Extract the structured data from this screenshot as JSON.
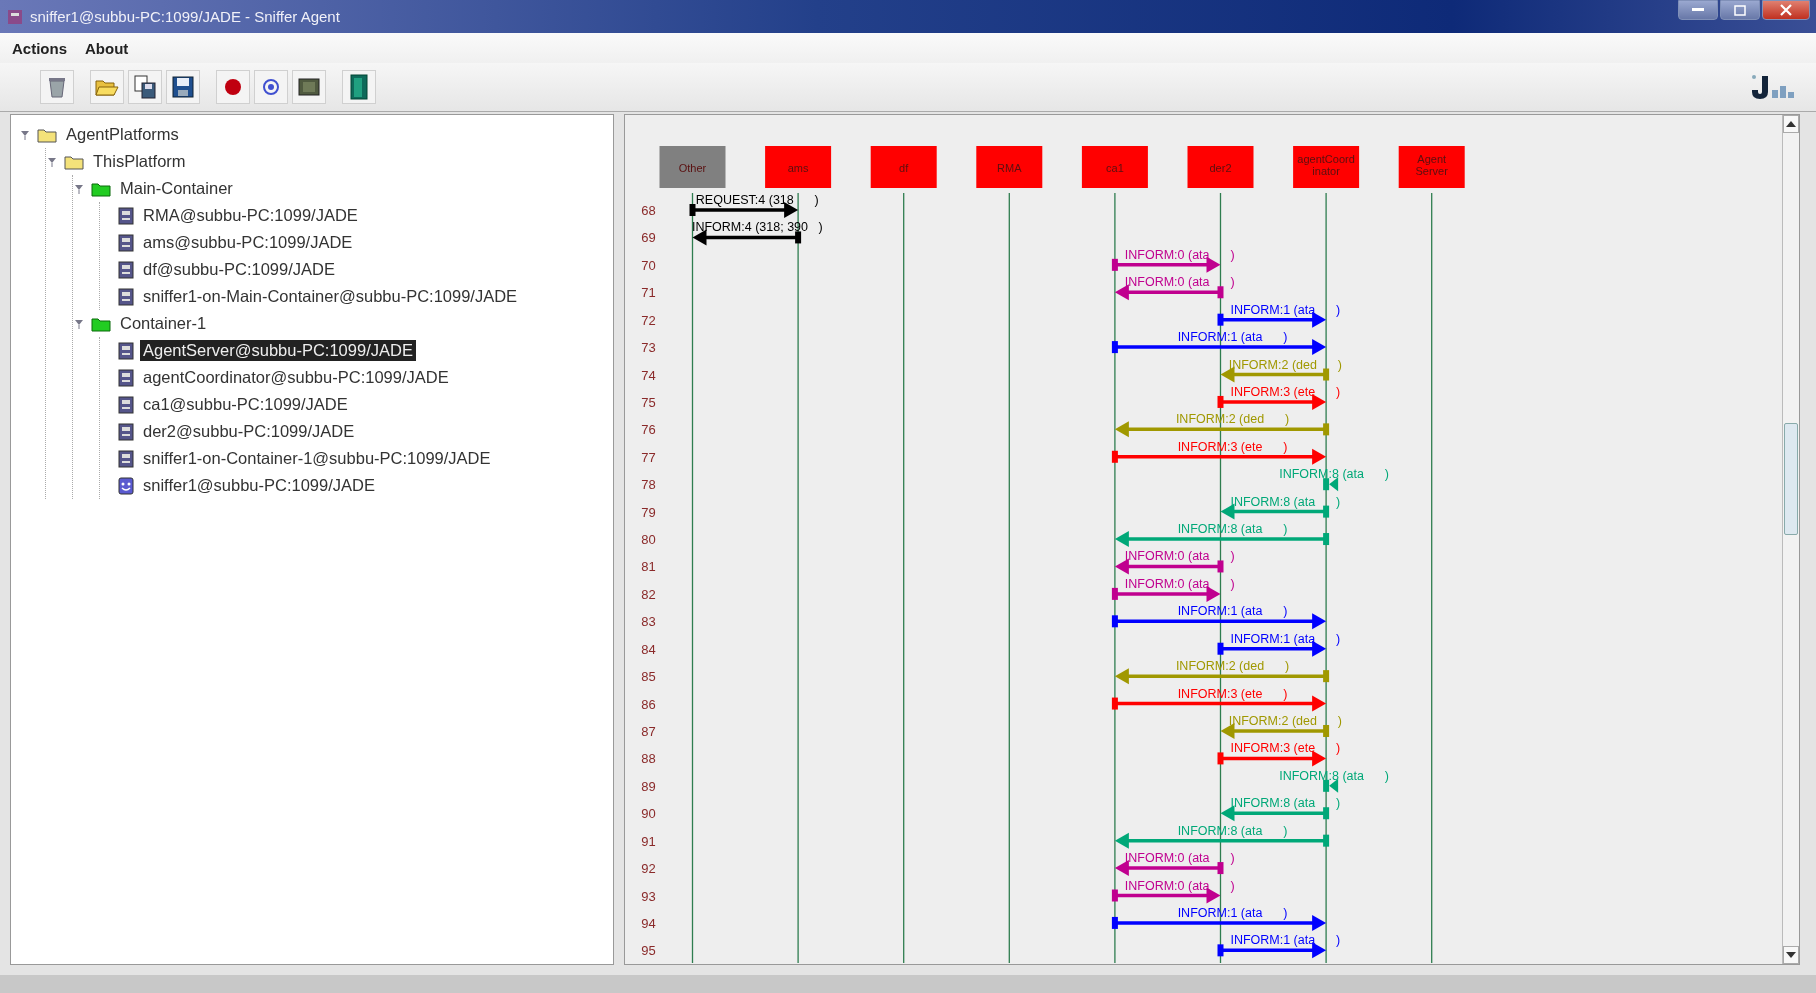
{
  "window": {
    "title": "sniffer1@subbu-PC:1099/JADE - Sniffer Agent"
  },
  "menu": [
    {
      "label": "Actions"
    },
    {
      "label": "About"
    }
  ],
  "tree": [
    {
      "label": "AgentPlatforms",
      "kind": "folder",
      "selected": false,
      "expanded": true,
      "children": [
        {
          "label": "ThisPlatform",
          "kind": "folder",
          "selected": false,
          "expanded": true,
          "children": [
            {
              "label": "Main-Container",
              "kind": "container",
              "selected": false,
              "expanded": true,
              "children": [
                {
                  "label": "RMA@subbu-PC:1099/JADE",
                  "kind": "agent",
                  "selected": false
                },
                {
                  "label": "ams@subbu-PC:1099/JADE",
                  "kind": "agent",
                  "selected": false
                },
                {
                  "label": "df@subbu-PC:1099/JADE",
                  "kind": "agent",
                  "selected": false
                },
                {
                  "label": "sniffer1-on-Main-Container@subbu-PC:1099/JADE",
                  "kind": "agent",
                  "selected": false
                }
              ]
            },
            {
              "label": "Container-1",
              "kind": "container",
              "selected": false,
              "expanded": true,
              "children": [
                {
                  "label": "AgentServer@subbu-PC:1099/JADE",
                  "kind": "agent",
                  "selected": true
                },
                {
                  "label": "agentCoordinator@subbu-PC:1099/JADE",
                  "kind": "agent",
                  "selected": false
                },
                {
                  "label": "ca1@subbu-PC:1099/JADE",
                  "kind": "agent",
                  "selected": false
                },
                {
                  "label": "der2@subbu-PC:1099/JADE",
                  "kind": "agent",
                  "selected": false
                },
                {
                  "label": "sniffer1-on-Container-1@subbu-PC:1099/JADE",
                  "kind": "agent",
                  "selected": false
                },
                {
                  "label": "sniffer1@subbu-PC:1099/JADE",
                  "kind": "sniffer",
                  "selected": false
                }
              ]
            }
          ]
        }
      ]
    }
  ],
  "agents": [
    {
      "label": "Other",
      "color": "#808080"
    },
    {
      "label": "ams",
      "color": "#ff0000"
    },
    {
      "label": "df",
      "color": "#ff0000"
    },
    {
      "label": "RMA",
      "color": "#ff0000"
    },
    {
      "label": "ca1",
      "color": "#ff0000"
    },
    {
      "label": "der2",
      "color": "#ff0000"
    },
    {
      "label": "agentCoord inator",
      "color": "#ff0000"
    },
    {
      "label": "Agent Server",
      "color": "#ff0000"
    }
  ],
  "messages": [
    {
      "row": "68",
      "label": "REQUEST:4 (318      )",
      "color": "#000000"
    },
    {
      "row": "69",
      "label": "INFORM:4 (318; 390   )",
      "color": "#000000"
    },
    {
      "row": "70",
      "label": "INFORM:0 (ata      )",
      "color": "#c0008f"
    },
    {
      "row": "71",
      "label": "INFORM:0 (ata      )",
      "color": "#c0008f"
    },
    {
      "row": "72",
      "label": "INFORM:1 (ata      )",
      "color": "#0000ff"
    },
    {
      "row": "73",
      "label": "INFORM:1 (ata      )",
      "color": "#0000ff"
    },
    {
      "row": "74",
      "label": "INFORM:2 (ded      )",
      "color": "#a09800"
    },
    {
      "row": "75",
      "label": "INFORM:3 (ete      )",
      "color": "#ff0000"
    },
    {
      "row": "76",
      "label": "INFORM:2 (ded      )",
      "color": "#a09800"
    },
    {
      "row": "77",
      "label": "INFORM:3 (ete      )",
      "color": "#ff0000"
    },
    {
      "row": "78",
      "label": "INFORM:8 (ata      )",
      "color": "#00a878"
    },
    {
      "row": "79",
      "label": "INFORM:8 (ata      )",
      "color": "#00a878"
    },
    {
      "row": "80",
      "label": "INFORM:8 (ata      )",
      "color": "#00a878"
    },
    {
      "row": "81",
      "label": "INFORM:0 (ata      )",
      "color": "#c0008f"
    },
    {
      "row": "82",
      "label": "INFORM:0 (ata      )",
      "color": "#c0008f"
    },
    {
      "row": "83",
      "label": "INFORM:1 (ata      )",
      "color": "#0000ff"
    },
    {
      "row": "84",
      "label": "INFORM:1 (ata      )",
      "color": "#0000ff"
    },
    {
      "row": "85",
      "label": "INFORM:2 (ded      )",
      "color": "#a09800"
    },
    {
      "row": "86",
      "label": "INFORM:3 (ete      )",
      "color": "#ff0000"
    },
    {
      "row": "87",
      "label": "INFORM:2 (ded      )",
      "color": "#a09800"
    },
    {
      "row": "88",
      "label": "INFORM:3 (ete      )",
      "color": "#ff0000"
    },
    {
      "row": "89",
      "label": "INFORM:8 (ata      )",
      "color": "#00a878"
    },
    {
      "row": "90",
      "label": "INFORM:8 (ata      )",
      "color": "#00a878"
    },
    {
      "row": "91",
      "label": "INFORM:8 (ata      )",
      "color": "#00a878"
    },
    {
      "row": "92",
      "label": "INFORM:0 (ata      )",
      "color": "#c0008f"
    },
    {
      "row": "93",
      "label": "INFORM:0 (ata      )",
      "color": "#c0008f"
    },
    {
      "row": "94",
      "label": "INFORM:1 (ata      )",
      "color": "#0000ff"
    },
    {
      "row": "95",
      "label": "INFORM:1 (ata      )",
      "color": "#0000ff"
    }
  ]
}
